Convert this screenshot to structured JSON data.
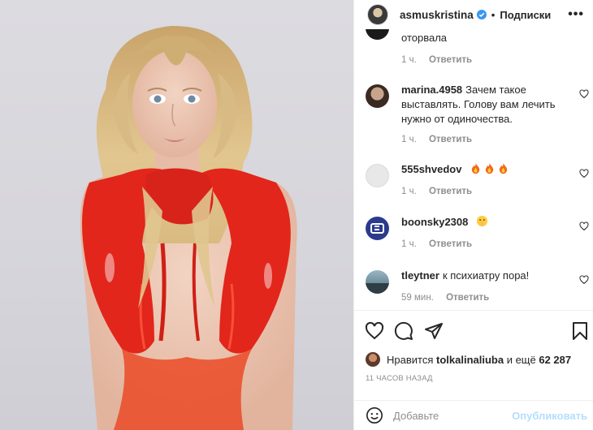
{
  "post": {
    "username": "asmuskristina",
    "separator": "•",
    "follow_label": "Подписки",
    "more_label": "•••",
    "verified_icon": "verified-badge-icon",
    "verified_color": "#3897f0"
  },
  "comments": [
    {
      "user": "",
      "text": "оторвала",
      "time": "1 ч.",
      "reply_label": "Ответить"
    },
    {
      "user": "marina.4958",
      "text": "Зачем такое выставлять. Голову вам лечить нужно от одиночества.",
      "time": "1 ч.",
      "reply_label": "Ответить"
    },
    {
      "user": "555shvedov",
      "text": "",
      "emojis": [
        "fire-emoji",
        "fire-emoji",
        "fire-emoji"
      ],
      "time": "1 ч.",
      "reply_label": "Ответить"
    },
    {
      "user": "boonsky2308",
      "text": "",
      "emojis": [
        "shushing-face-emoji"
      ],
      "time": "1 ч.",
      "reply_label": "Ответить"
    },
    {
      "user": "tleytner",
      "text": "к психиатру пора!",
      "time": "59 мин.",
      "reply_label": "Ответить"
    }
  ],
  "actions": {
    "icons": [
      "heart-icon",
      "comment-icon",
      "share-icon",
      "bookmark-icon"
    ]
  },
  "likes": {
    "prefix": "Нравится",
    "user": "tolkalinaliuba",
    "middle": "и ещё",
    "count": "62 287"
  },
  "time_ago": "11 ЧАСОВ НАЗАД",
  "add_comment": {
    "placeholder": "Добавьте",
    "publish_label": "Опубликовать",
    "publish_color": "#b2dffc"
  }
}
